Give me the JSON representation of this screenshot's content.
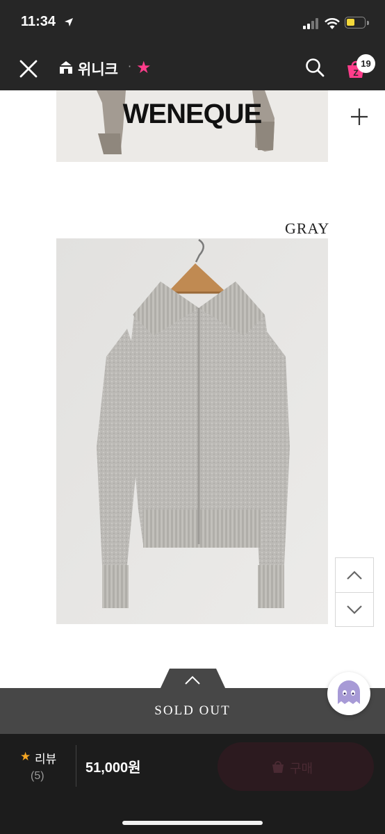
{
  "status_bar": {
    "time": "11:34"
  },
  "nav": {
    "title": "위니크",
    "separator": "·",
    "cart_badge": "19"
  },
  "banner": {
    "brand": "WENEQUE"
  },
  "product": {
    "color_label": "GRAY"
  },
  "soldout_bar": {
    "label": "SOLD OUT"
  },
  "purchase_bar": {
    "review_label": "리뷰",
    "review_count": "(5)",
    "price": "51,000원",
    "buy_label": "구매"
  },
  "colors": {
    "accent_pink": "#ff3d8b",
    "star_orange": "#f5a623",
    "dark_bg": "#262626"
  }
}
